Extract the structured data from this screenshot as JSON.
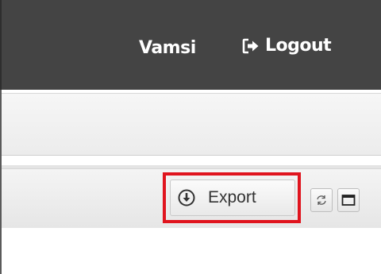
{
  "header": {
    "username": "Vamsi",
    "logout_label": "Logout",
    "logout_icon": "sign-out-icon"
  },
  "toolbar": {
    "export_label": "Export",
    "export_icon": "download-circle-icon",
    "refresh_icon": "refresh-icon",
    "maximize_icon": "maximize-window-icon"
  },
  "colors": {
    "header_bg": "#444444",
    "highlight_border": "#e0141e"
  }
}
